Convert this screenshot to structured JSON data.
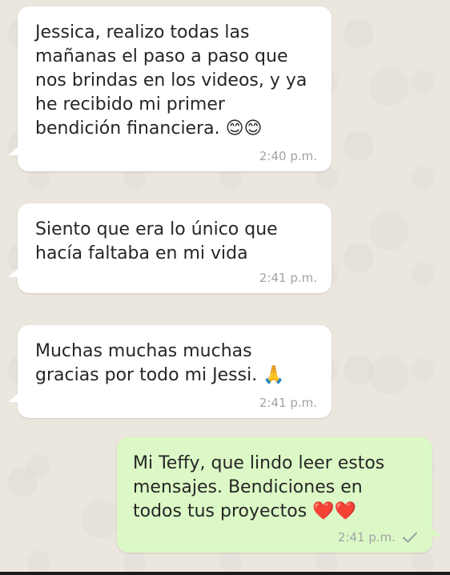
{
  "conversation": {
    "messages": [
      {
        "direction": "incoming",
        "text": "Jessica, realizo todas las\nmañanas el paso a paso que\nnos brindas en los videos, y ya\nhe recibido mi primer\nbendición financiera. 😊😊",
        "time": "2:40 p.m."
      },
      {
        "direction": "incoming",
        "text": "Siento que era lo único que\nhacía faltaba en mi vida",
        "time": "2:41 p.m."
      },
      {
        "direction": "incoming",
        "text": "Muchas muchas muchas\ngracias por todo mi Jessi. 🙏",
        "time": "2:41 p.m."
      },
      {
        "direction": "outgoing",
        "text": "Mi Teffy, que lindo leer estos\nmensajes. Bendiciones en\ntodos tus proyectos ❤️❤️",
        "time": "2:41 p.m.",
        "status_icon": "sent-check-icon"
      }
    ]
  },
  "colors": {
    "chat_background": "#ebe6de",
    "incoming_bubble": "#ffffff",
    "outgoing_bubble": "#dcf8c6",
    "timestamp": "#a3a3a3"
  }
}
